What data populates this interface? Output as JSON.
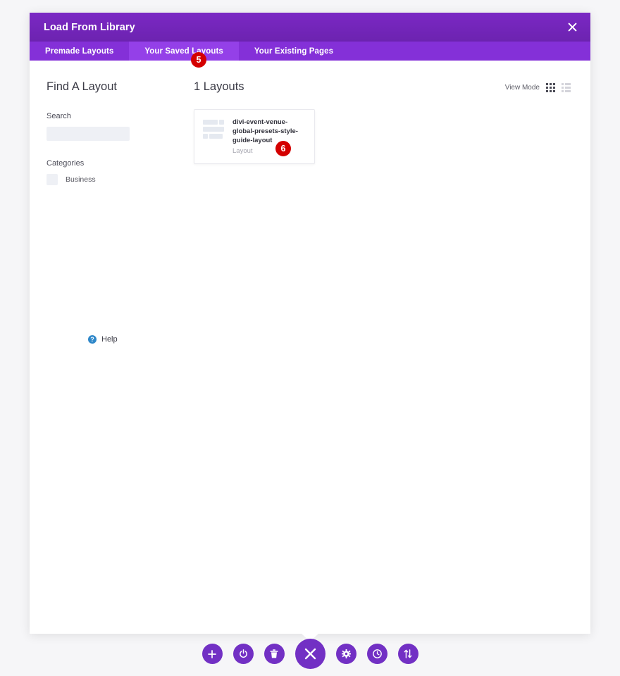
{
  "modal": {
    "title": "Load From Library",
    "close_icon": "close-icon",
    "tabs": [
      {
        "label": "Premade Layouts",
        "active": false
      },
      {
        "label": "Your Saved Layouts",
        "active": true
      },
      {
        "label": "Your Existing Pages",
        "active": false
      }
    ]
  },
  "sidebar": {
    "heading": "Find A Layout",
    "search": {
      "label": "Search",
      "value": "",
      "placeholder": ""
    },
    "categories": {
      "label": "Categories",
      "items": [
        {
          "name": "Business",
          "checked": false
        }
      ]
    },
    "help": {
      "icon": "question-mark-icon",
      "label": "Help"
    }
  },
  "main": {
    "count_label": "1 Layouts",
    "view_mode": {
      "label": "View Mode",
      "grid_icon": "grid-view-icon",
      "list_icon": "list-view-icon",
      "selected": "grid"
    },
    "layouts": [
      {
        "title": "divi-event-venue-global-presets-style-guide-layout",
        "subtitle": "Layout"
      }
    ]
  },
  "badges": [
    {
      "id": "badge-5",
      "number": "5"
    },
    {
      "id": "badge-6",
      "number": "6"
    }
  ],
  "toolbar": {
    "buttons": [
      {
        "name": "add-button",
        "icon": "plus-icon",
        "primary": false
      },
      {
        "name": "power-button",
        "icon": "power-icon",
        "primary": false
      },
      {
        "name": "delete-button",
        "icon": "trash-icon",
        "primary": false
      },
      {
        "name": "close-builder-button",
        "icon": "close-x-icon",
        "primary": true
      },
      {
        "name": "settings-button",
        "icon": "gear-icon",
        "primary": false
      },
      {
        "name": "history-button",
        "icon": "clock-icon",
        "primary": false
      },
      {
        "name": "sort-button",
        "icon": "sort-arrows-icon",
        "primary": false
      }
    ]
  },
  "colors": {
    "brand_purple": "#7230c4",
    "titlebar_purple": "#7b28c4",
    "tabbar_purple": "#8430d8",
    "tab_active_purple": "#9440e8",
    "badge_red": "#d40000",
    "help_blue": "#2e87c9",
    "page_background": "#f6f6f8"
  }
}
